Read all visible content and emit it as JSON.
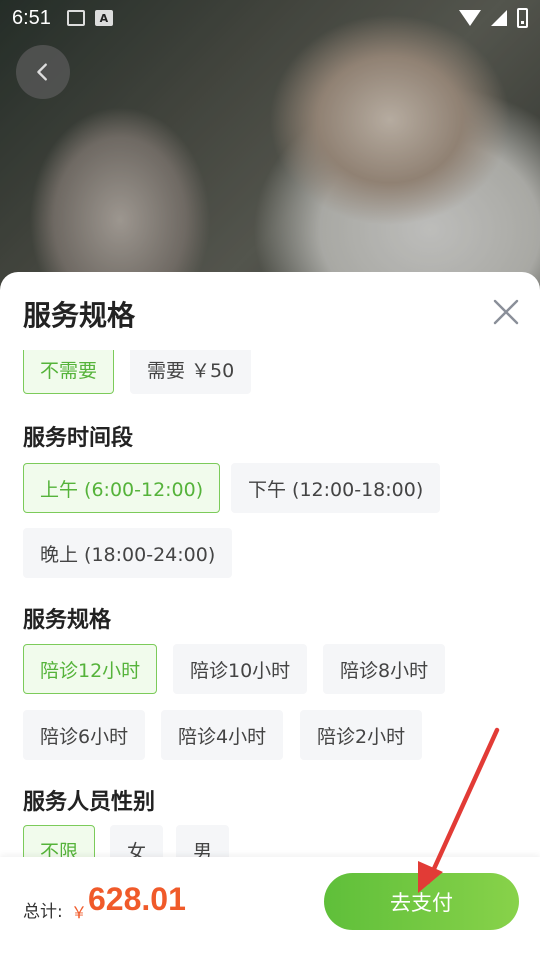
{
  "status_bar": {
    "time": "6:51",
    "notif_letter": "A"
  },
  "sheet": {
    "title": "服务规格"
  },
  "groups": {
    "top": {
      "options": [
        "不需要",
        "需要 ￥50"
      ],
      "selected": 0
    },
    "time": {
      "label": "服务时间段",
      "options": [
        "上午 (6:00-12:00)",
        "下午 (12:00-18:00)",
        "晚上 (18:00-24:00)"
      ],
      "selected": 0
    },
    "spec": {
      "label": "服务规格",
      "options": [
        "陪诊12小时",
        "陪诊10小时",
        "陪诊8小时",
        "陪诊6小时",
        "陪诊4小时",
        "陪诊2小时"
      ],
      "selected": 0
    },
    "gender": {
      "label": "服务人员性别",
      "options": [
        "不限",
        "女",
        "男"
      ],
      "selected": 0
    }
  },
  "footer": {
    "total_label": "总计:",
    "currency": "￥",
    "total_amount": "628.01",
    "pay_label": "去支付"
  },
  "colors": {
    "accent": "#55b33a",
    "price": "#f05a2a",
    "arrow": "#e23b36"
  }
}
